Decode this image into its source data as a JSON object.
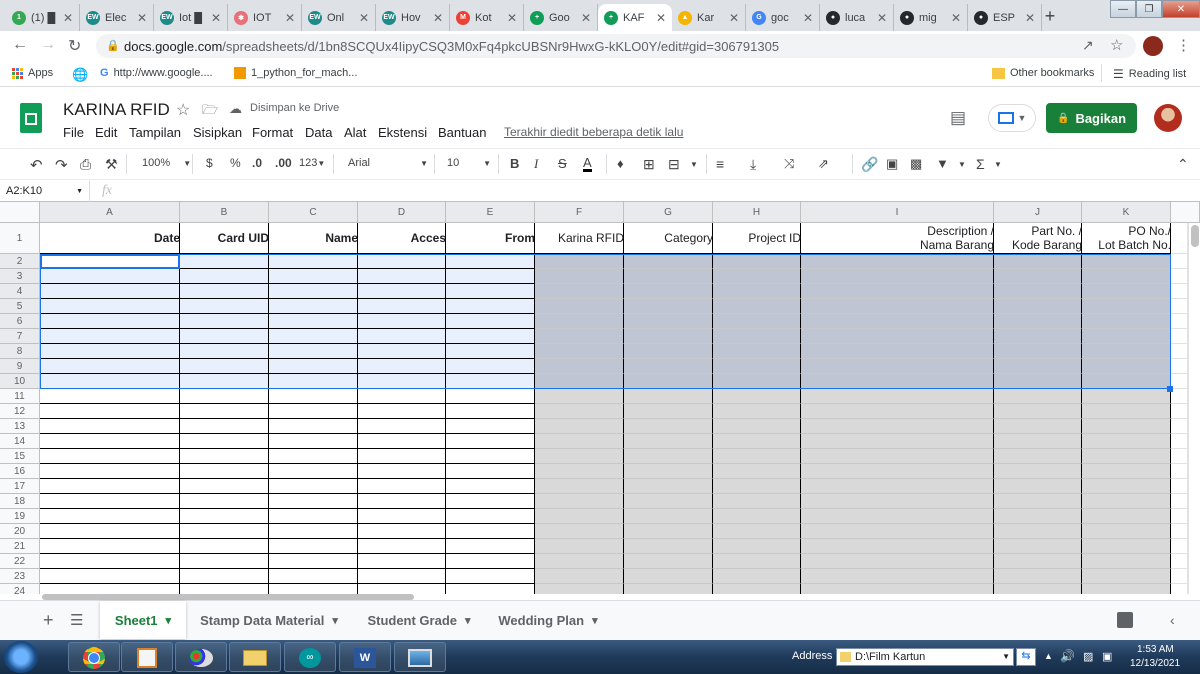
{
  "browser": {
    "tabs": [
      {
        "title": "(1) █",
        "fav": "green-counter-icon",
        "color": "#34a853",
        "glyph": "1"
      },
      {
        "title": "Elec",
        "fav": "ew-icon",
        "color": "#1f8a8a",
        "glyph": "EW"
      },
      {
        "title": "Iot █",
        "fav": "ew-icon",
        "color": "#1f8a8a",
        "glyph": "EW"
      },
      {
        "title": "IOT",
        "fav": "nodes-icon",
        "color": "#e8707a",
        "glyph": "✱"
      },
      {
        "title": "Onl",
        "fav": "ew-icon",
        "color": "#1f8a8a",
        "glyph": "EW"
      },
      {
        "title": "Hov",
        "fav": "ew-icon",
        "color": "#1f8a8a",
        "glyph": "EW"
      },
      {
        "title": "Kot",
        "fav": "gmail-icon",
        "color": "#ea4335",
        "glyph": "M"
      },
      {
        "title": "Goo",
        "fav": "sheets-icon",
        "color": "#0f9d58",
        "glyph": "+"
      },
      {
        "title": "KAF",
        "fav": "sheets-icon",
        "color": "#0f9d58",
        "glyph": "+"
      },
      {
        "title": "Kar",
        "fav": "chart-icon",
        "color": "#f4b400",
        "glyph": "▲"
      },
      {
        "title": "goc",
        "fav": "google-icon",
        "color": "#4285f4",
        "glyph": "G"
      },
      {
        "title": "luca",
        "fav": "github-icon",
        "color": "#24292e",
        "glyph": "●"
      },
      {
        "title": "mig",
        "fav": "github-icon",
        "color": "#24292e",
        "glyph": "●"
      },
      {
        "title": "ESP",
        "fav": "github-icon",
        "color": "#24292e",
        "glyph": "●"
      }
    ],
    "active_tab": 8,
    "url_host": "docs.google.com",
    "url_path": "/spreadsheets/d/1bn8SCQUx4IipyCSQ3M0xFq4pkcUBSNr9HwxG-kKLO0Y/edit#gid=306791305",
    "bookmarks": {
      "apps": "Apps",
      "google": "http://www.google....",
      "python": "1_python_for_mach...",
      "other": "Other bookmarks",
      "reading": "Reading list"
    }
  },
  "doc": {
    "title": "KARINA RFID",
    "saved": "Disimpan ke Drive",
    "menus": [
      "File",
      "Edit",
      "Tampilan",
      "Sisipkan",
      "Format",
      "Data",
      "Alat",
      "Ekstensi",
      "Bantuan"
    ],
    "last_edit": "Terakhir diedit beberapa detik lalu",
    "share": "Bagikan"
  },
  "toolbar": {
    "zoom": "100%",
    "currency": "$",
    "percent": "%",
    "dec_minus": ".0",
    "dec_plus": ".00",
    "more_formats": "123",
    "font": "Arial",
    "size": "10",
    "bold": "B",
    "italic": "I",
    "strike": "S",
    "textcolor": "A"
  },
  "formula": {
    "namebox": "A2:K10",
    "fx": "fx"
  },
  "sheet": {
    "columns": [
      "A",
      "B",
      "C",
      "D",
      "E",
      "F",
      "G",
      "H",
      "I",
      "J",
      "K"
    ],
    "headers": [
      {
        "line1": "",
        "line2": "Date",
        "bold": true
      },
      {
        "line1": "",
        "line2": "Card UID",
        "bold": true
      },
      {
        "line1": "",
        "line2": "Name",
        "bold": true
      },
      {
        "line1": "",
        "line2": "Acces",
        "bold": true
      },
      {
        "line1": "",
        "line2": "From",
        "bold": true
      },
      {
        "line1": "",
        "line2": "Karina RFID",
        "bold": false
      },
      {
        "line1": "",
        "line2": "Category",
        "bold": false
      },
      {
        "line1": "",
        "line2": "Project ID",
        "bold": false
      },
      {
        "line1": "Description /",
        "line2": "Nama Barang",
        "bold": false
      },
      {
        "line1": "Part No. /",
        "line2": "Kode Barang",
        "bold": false
      },
      {
        "line1": "PO No./",
        "line2": "Lot Batch No.",
        "bold": false
      }
    ],
    "row_numbers": [
      "1",
      "2",
      "3",
      "4",
      "5",
      "6",
      "7",
      "8",
      "9",
      "10",
      "11",
      "12",
      "13",
      "14",
      "15",
      "16",
      "17",
      "18",
      "19",
      "20",
      "21",
      "22",
      "23",
      "24"
    ]
  },
  "sheets": {
    "tabs": [
      "Sheet1",
      "Stamp Data Material",
      "Student Grade",
      "Wedding Plan"
    ],
    "active": 0
  },
  "taskbar": {
    "address_label": "Address",
    "address_value": "D:\\Film Kartun",
    "time": "1:53 AM",
    "date": "12/13/2021"
  }
}
